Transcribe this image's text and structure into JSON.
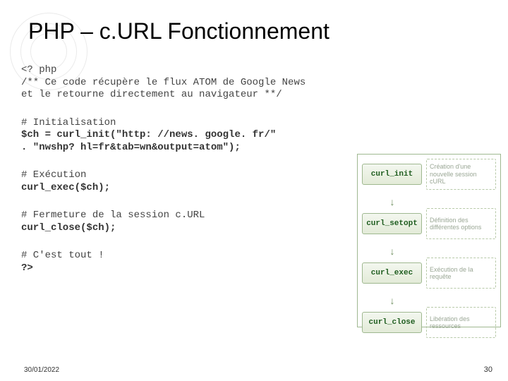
{
  "title": "PHP – c.URL Fonctionnement",
  "code": {
    "open": "<? php",
    "doc1": "/** Ce code récupère le flux ATOM de Google News",
    "doc2": "et le retourne directement au navigateur **/",
    "init_c": "# Initialisation",
    "init_l1": "$ch = curl_init(\"http: //news. google. fr/\"",
    "init_l2": ". \"nwshp? hl=fr&tab=wn&output=atom\");",
    "exec_c": "# Exécution",
    "exec_l": "curl_exec($ch);",
    "close_c": "# Fermeture de la session c.URL",
    "close_l": "curl_close($ch);",
    "end_c": "# C'est tout !",
    "end_l": "?>"
  },
  "diagram": {
    "b1": "curl_init",
    "b2": "curl_setopt",
    "b3": "curl_exec",
    "b4": "curl_close",
    "r1": "Création d'une nouvelle session cURL",
    "r2": "Définition des différentes options",
    "r3": "Exécution de la requête",
    "r4": "Libération des ressources",
    "arrow": "↓"
  },
  "footer": {
    "date": "30/01/2022",
    "page": "30"
  }
}
